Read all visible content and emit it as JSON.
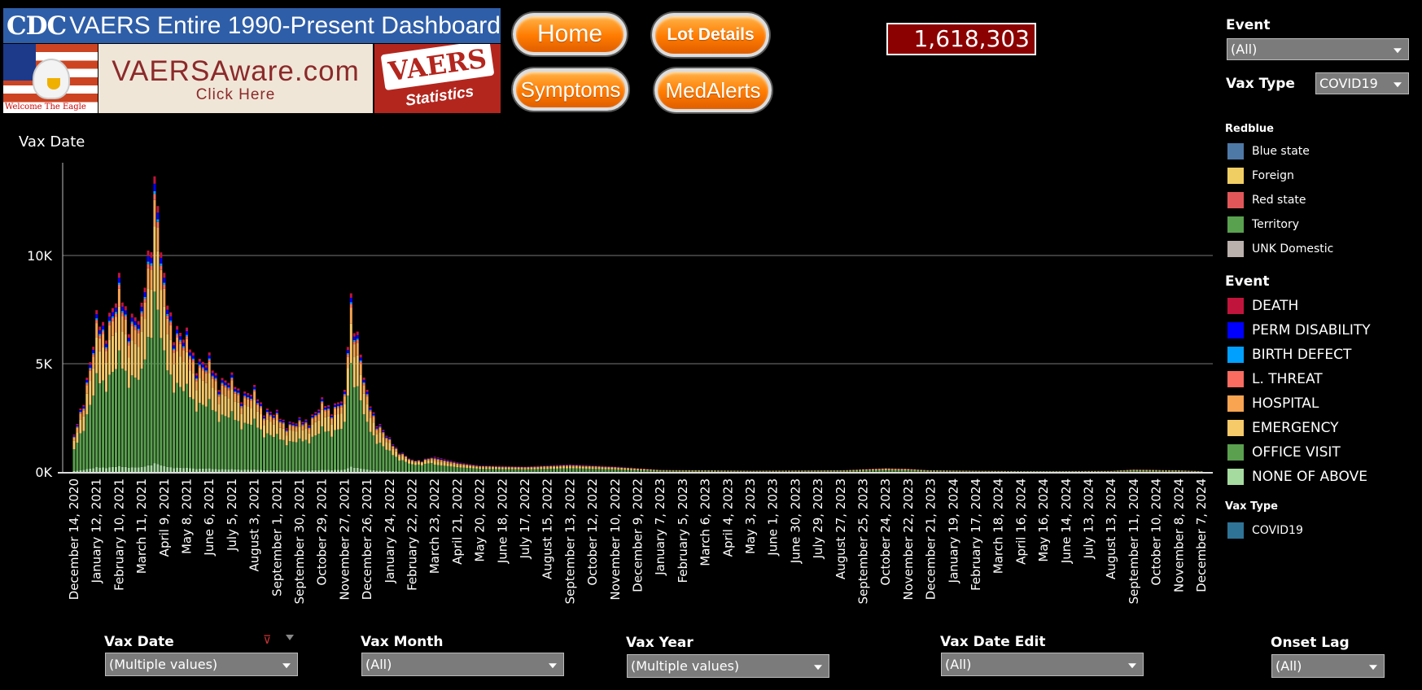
{
  "header": {
    "cdc_logo": "CDC",
    "cdc_title": "VAERS Entire 1990-Present Dashboard",
    "eagle_caption": "Welcome The Eagle",
    "vaersaware_main": "VAERSAware.com",
    "vaersaware_sub": "Click Here",
    "vaers_stats_main": "VAERS",
    "vaers_stats_sub": "Statistics"
  },
  "buttons": {
    "home": "Home",
    "lot_details": "Lot Details",
    "symptoms": "Symptoms",
    "medalerts": "MedAlerts"
  },
  "counter": {
    "value": "1,618,303"
  },
  "filters": {
    "event": {
      "label": "Event",
      "value": "(All)"
    },
    "vax_type": {
      "label": "Vax Type",
      "value": "COVID19"
    },
    "vax_date": {
      "label": "Vax Date",
      "value": "(Multiple values)"
    },
    "vax_month": {
      "label": "Vax Month",
      "value": "(All)"
    },
    "vax_year": {
      "label": "Vax Year",
      "value": "(Multiple values)"
    },
    "vax_date_edit": {
      "label": "Vax Date Edit",
      "value": "(All)"
    },
    "onset_lag": {
      "label": "Onset Lag",
      "value": "(All)"
    }
  },
  "legends": {
    "redblue": {
      "title": "Redblue",
      "items": [
        {
          "label": "Blue state",
          "color": "#4e79a7"
        },
        {
          "label": "Foreign",
          "color": "#f1ce63"
        },
        {
          "label": "Red state",
          "color": "#e15759"
        },
        {
          "label": "Territory",
          "color": "#59a14f"
        },
        {
          "label": "UNK Domestic",
          "color": "#bab0ac"
        }
      ]
    },
    "event": {
      "title": "Event",
      "items": [
        {
          "label": "DEATH",
          "color": "#c0143c"
        },
        {
          "label": "PERM DISABILITY",
          "color": "#0000ff"
        },
        {
          "label": "BIRTH DEFECT",
          "color": "#00a0ff"
        },
        {
          "label": "L. THREAT",
          "color": "#fa6b60"
        },
        {
          "label": "HOSPITAL",
          "color": "#f8a451"
        },
        {
          "label": "EMERGENCY",
          "color": "#f6c969"
        },
        {
          "label": "OFFICE VISIT",
          "color": "#5aa04f"
        },
        {
          "label": "NONE OF ABOVE",
          "color": "#a6dba0"
        }
      ]
    },
    "vax_type": {
      "title": "Vax Type",
      "items": [
        {
          "label": "COVID19",
          "color": "#2f7396"
        }
      ]
    }
  },
  "chart_data": {
    "type": "bar",
    "stacked": true,
    "title": "Vax Date",
    "xlabel": "",
    "ylabel": "",
    "ylim": [
      0,
      14000
    ],
    "y_ticks": [
      {
        "value": 0,
        "label": "0K"
      },
      {
        "value": 5000,
        "label": "5K"
      },
      {
        "value": 10000,
        "label": "10K"
      }
    ],
    "grid": true,
    "x_tick_labels": [
      "December 14, 2020",
      "January 12, 2021",
      "February 10, 2021",
      "March 11, 2021",
      "April 9, 2021",
      "May 8, 2021",
      "June 6, 2021",
      "July 5, 2021",
      "August 3, 2021",
      "September 1, 2021",
      "September 30, 2021",
      "October 29, 2021",
      "November 27, 2021",
      "December 26, 2021",
      "January 24, 2022",
      "February 22, 2022",
      "March 23, 2022",
      "April 21, 2022",
      "May 20, 2022",
      "June 18, 2022",
      "July 17, 2022",
      "August 15, 2022",
      "September 13, 2022",
      "October 12, 2022",
      "November 10, 2022",
      "December 9, 2022",
      "January 7, 2023",
      "February 5, 2023",
      "March 6, 2023",
      "April 4, 2023",
      "May 3, 2023",
      "June 1, 2023",
      "June 30, 2023",
      "July 29, 2023",
      "August 27, 2023",
      "September 25, 2023",
      "October 24, 2023",
      "November 22, 2023",
      "December 21, 2023",
      "January 19, 2024",
      "February 17, 2024",
      "March 18, 2024",
      "April 16, 2024",
      "May 16, 2024",
      "June 14, 2024",
      "July 13, 2024",
      "August 13, 2024",
      "September 11, 2024",
      "October 10, 2024",
      "November 8, 2024",
      "December 7, 2024"
    ],
    "series_order": [
      "NONE OF ABOVE",
      "OFFICE VISIT",
      "EMERGENCY",
      "HOSPITAL",
      "L. THREAT",
      "BIRTH DEFECT",
      "PERM DISABILITY",
      "DEATH"
    ],
    "share_by_period": [
      {
        "until_tick": 16,
        "share": [
          0.03,
          0.58,
          0.22,
          0.09,
          0.02,
          0.01,
          0.025,
          0.025
        ]
      },
      {
        "until_tick": 51,
        "share": [
          0.03,
          0.45,
          0.25,
          0.12,
          0.04,
          0.01,
          0.05,
          0.05
        ]
      }
    ],
    "totals_approx": [
      {
        "tick": 0,
        "total": 1500
      },
      {
        "tick": 1,
        "total": 6500
      },
      {
        "tick": 2,
        "total": 8000
      },
      {
        "tick": 3,
        "total": 6800
      },
      {
        "tick": 3.6,
        "total": 14000
      },
      {
        "tick": 4,
        "total": 8000
      },
      {
        "tick": 5,
        "total": 5800
      },
      {
        "tick": 6,
        "total": 4800
      },
      {
        "tick": 7,
        "total": 4000
      },
      {
        "tick": 8,
        "total": 3500
      },
      {
        "tick": 9,
        "total": 2500
      },
      {
        "tick": 10,
        "total": 2200
      },
      {
        "tick": 11,
        "total": 3000
      },
      {
        "tick": 12,
        "total": 3300
      },
      {
        "tick": 12.3,
        "total": 8500
      },
      {
        "tick": 13,
        "total": 3300
      },
      {
        "tick": 14,
        "total": 1400
      },
      {
        "tick": 15,
        "total": 500
      },
      {
        "tick": 16,
        "total": 700
      },
      {
        "tick": 17,
        "total": 450
      },
      {
        "tick": 18,
        "total": 300
      },
      {
        "tick": 20,
        "total": 250
      },
      {
        "tick": 22,
        "total": 350
      },
      {
        "tick": 24,
        "total": 250
      },
      {
        "tick": 26,
        "total": 100
      },
      {
        "tick": 30,
        "total": 60
      },
      {
        "tick": 34,
        "total": 80
      },
      {
        "tick": 36,
        "total": 180
      },
      {
        "tick": 37,
        "total": 150
      },
      {
        "tick": 38,
        "total": 80
      },
      {
        "tick": 42,
        "total": 40
      },
      {
        "tick": 46,
        "total": 50
      },
      {
        "tick": 47,
        "total": 120
      },
      {
        "tick": 49,
        "total": 80
      },
      {
        "tick": 50,
        "total": 40
      }
    ]
  }
}
